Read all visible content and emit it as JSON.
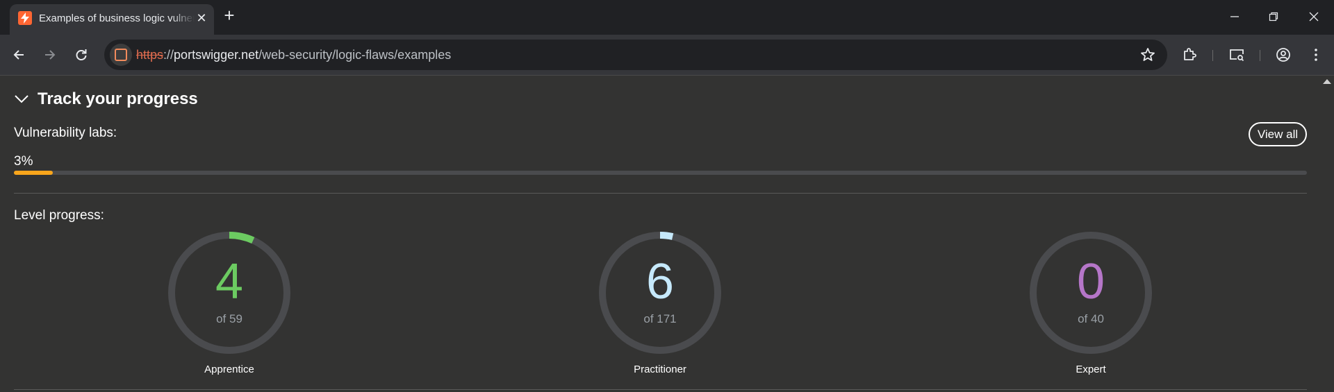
{
  "browser": {
    "tab_title": "Examples of business logic vulnerabilities",
    "url_scheme": "https",
    "url_sep": "://",
    "url_host": "portswigger.net",
    "url_path": "/web-security/logic-flaws/examples"
  },
  "page": {
    "section_title": "Track your progress",
    "vulnerability_label": "Vulnerability labs:",
    "view_all_label": "View all",
    "progress_percent_label": "3%",
    "progress_fraction": 0.03,
    "level_progress_label": "Level progress:",
    "levels": [
      {
        "count": "4",
        "total": "of 59",
        "name": "Apprentice",
        "fraction": 0.0678,
        "color": "#6ccb61"
      },
      {
        "count": "6",
        "total": "of 171",
        "name": "Practitioner",
        "fraction": 0.0351,
        "color": "#c6e9fb"
      },
      {
        "count": "0",
        "total": "of 40",
        "name": "Expert",
        "fraction": 0,
        "color": "#b576c8"
      }
    ]
  },
  "colors": {
    "progress_fill": "#f8a51c",
    "track": "#4a4b4e",
    "brand": "#ff6633"
  }
}
